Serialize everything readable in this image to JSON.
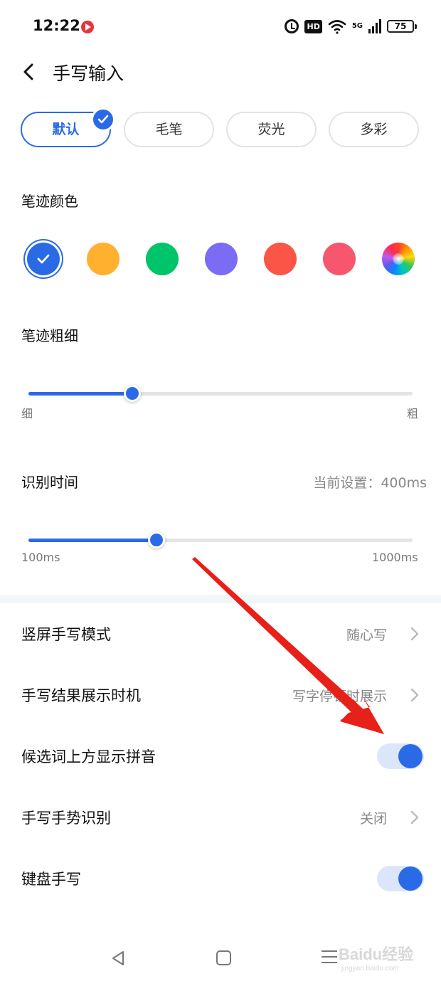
{
  "status_bar": {
    "time": "12:22",
    "hd_label": "HD",
    "network_label": "5G",
    "battery": "75",
    "icons": [
      "video-app-icon",
      "alarm-icon",
      "hd-icon",
      "wifi-icon",
      "signal-icon",
      "battery-icon"
    ]
  },
  "header": {
    "title": "手写输入",
    "back_icon": "chevron-left-icon"
  },
  "styles": {
    "options": [
      "默认",
      "毛笔",
      "荧光",
      "多彩"
    ],
    "selected": "默认"
  },
  "stroke_color": {
    "label": "笔迹颜色",
    "swatches": [
      "#2a6ae6",
      "#ffb02e",
      "#00c46a",
      "#7b6cf6",
      "#fa5546",
      "#f6566e",
      "multicolor"
    ],
    "selected_index": 0
  },
  "stroke_width": {
    "label": "笔迹粗细",
    "min_label": "细",
    "max_label": "粗",
    "value_fraction": 0.27
  },
  "recognition_time": {
    "label": "识别时间",
    "current_setting": "当前设置：400ms",
    "min_label": "100ms",
    "max_label": "1000ms",
    "value_ms": 400,
    "min_ms": 100,
    "max_ms": 1000
  },
  "settings": {
    "portrait_mode": {
      "label": "竖屏手写模式",
      "value": "随心写"
    },
    "result_timing": {
      "label": "手写结果展示时机",
      "value": "写字停顿时展示"
    },
    "pinyin_above": {
      "label": "候选词上方显示拼音",
      "enabled": true
    },
    "gesture": {
      "label": "手写手势识别",
      "value": "关闭"
    },
    "keyboard_handwriting": {
      "label": "键盘手写",
      "enabled": true
    }
  },
  "nav_bar": {
    "icons": [
      "nav-back-icon",
      "nav-home-icon",
      "nav-menu-icon"
    ]
  },
  "watermark": {
    "text": "Baidu经验",
    "url_text": "jingyan.baidu.com"
  },
  "colors": {
    "accent": "#2a6ae6",
    "toggle_track": "#dbe6fb",
    "annotation_arrow": "#e8201a"
  }
}
